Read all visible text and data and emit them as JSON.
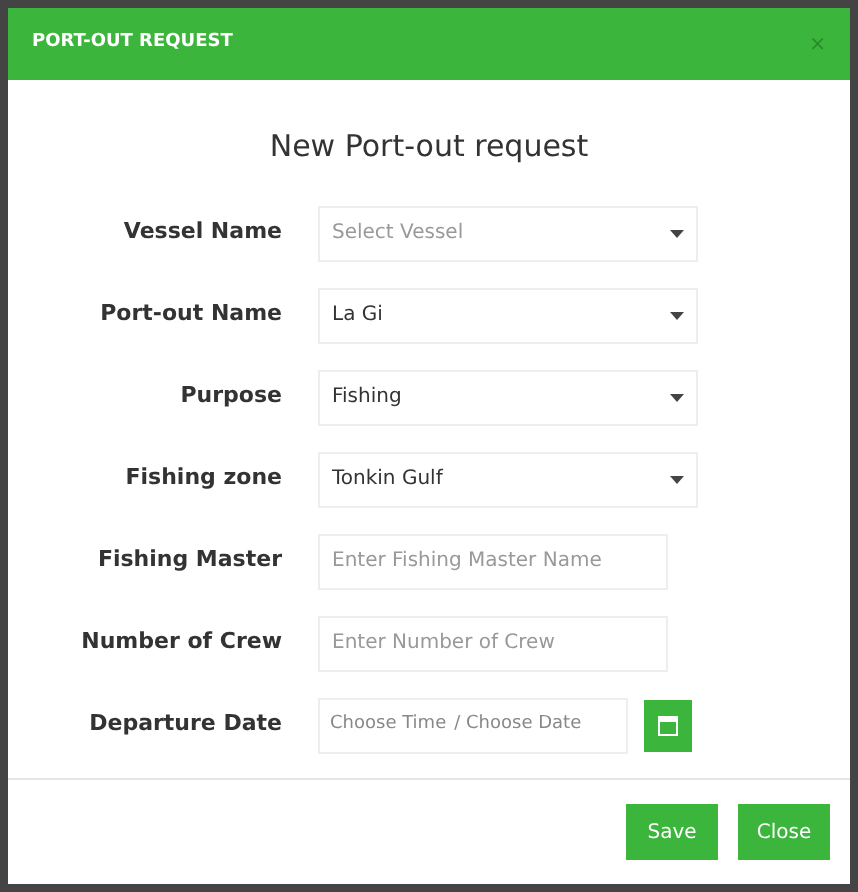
{
  "dialog": {
    "title": "PORT-OUT REQUEST",
    "close": "×"
  },
  "form": {
    "heading": "New Port-out request",
    "fields": [
      {
        "kind": "select",
        "label": "Vessel Name",
        "placeholder": "Select Vessel"
      },
      {
        "kind": "select",
        "label": "Port-out Name",
        "value": "La Gi"
      },
      {
        "kind": "select",
        "label": "Purpose",
        "value": "Fishing"
      },
      {
        "kind": "select",
        "label": "Fishing zone",
        "value": "Tonkin Gulf"
      },
      {
        "kind": "text",
        "label": "Fishing Master",
        "placeholder": "Enter Fishing Master Name"
      },
      {
        "kind": "text",
        "label": "Number of Crew",
        "placeholder": "Enter Number of Crew"
      },
      {
        "kind": "datetime",
        "label": "Departure Date",
        "time_placeholder": "Choose Time",
        "date_placeholder": "/ Choose Date"
      }
    ]
  },
  "buttons": [
    "Save",
    "Close"
  ]
}
